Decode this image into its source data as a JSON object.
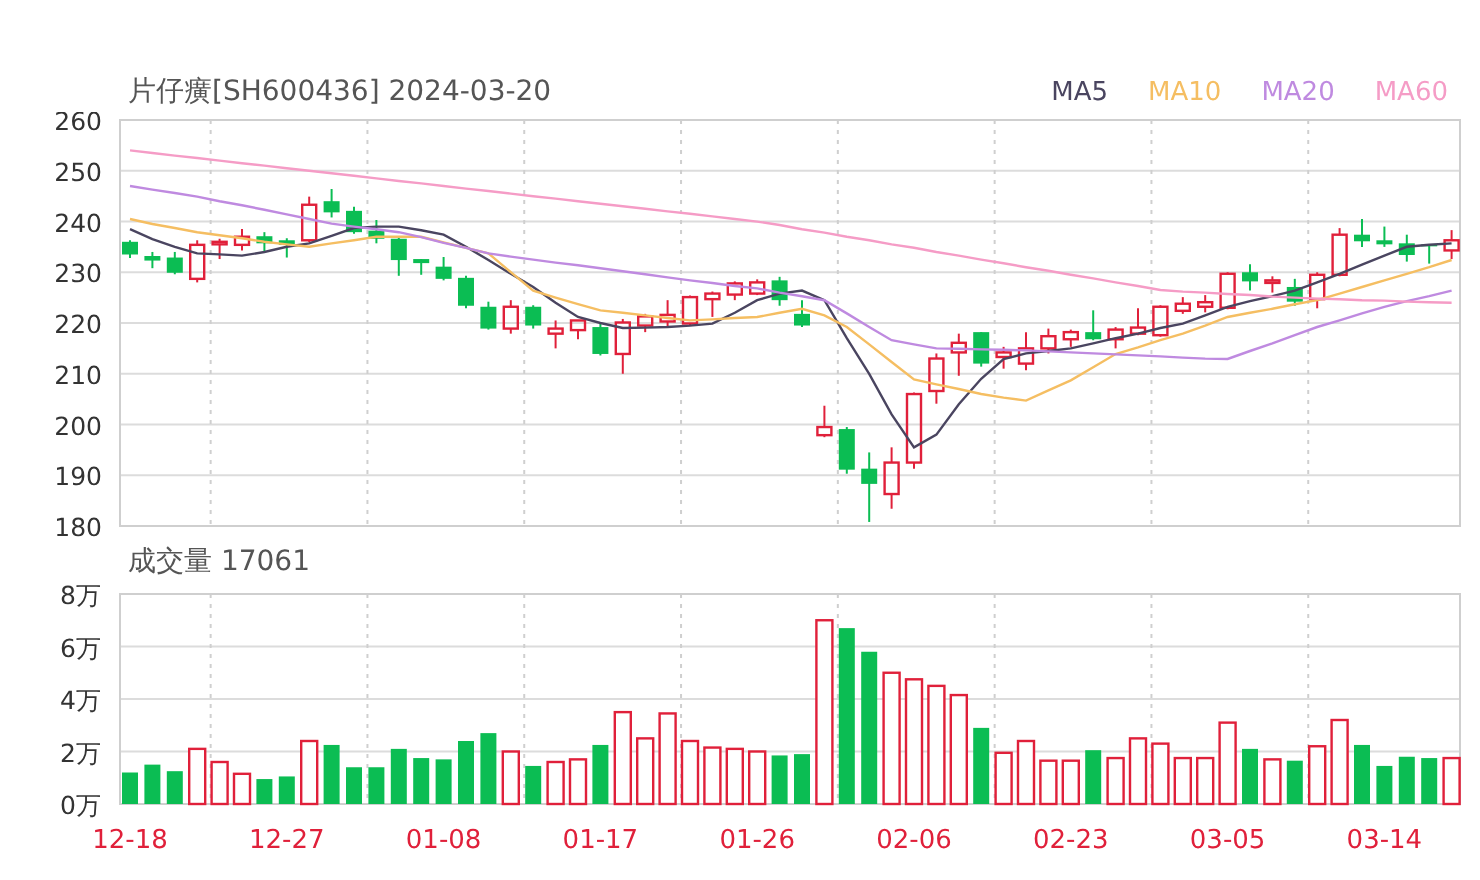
{
  "price_panel": {
    "title": "片仔癀[SH600436] 2024-03-20",
    "chart_data": {
      "type": "candlestick",
      "grid": true,
      "ylim": [
        180,
        260
      ],
      "yticks": [
        180,
        190,
        200,
        210,
        220,
        230,
        240,
        250,
        260
      ],
      "series": [
        {
          "name": "MA5",
          "type": "line",
          "color": "#4a4560",
          "values": [
            238.5,
            236.5,
            235,
            233.7,
            233.5,
            233.3,
            234,
            235,
            235.7,
            237.2,
            238.7,
            239,
            239,
            238.3,
            237.4,
            235,
            232.4,
            229.7,
            227.1,
            224,
            221.2,
            220,
            219,
            219.1,
            219.2,
            219.5,
            219.9,
            222,
            224.5,
            225.8,
            226.4,
            224.5,
            217,
            210,
            202,
            195.5,
            198,
            204,
            209,
            212.9,
            214,
            214.5,
            215,
            216,
            217,
            217.9,
            219,
            219.9,
            221.5,
            223.2,
            224.3,
            225.3,
            226.4,
            228,
            229.7,
            231.5,
            233.3,
            235,
            235.4,
            235.7
          ]
        },
        {
          "name": "MA10",
          "type": "line",
          "color": "#f5be62",
          "values": [
            240.5,
            239.5,
            238.7,
            237.9,
            237.3,
            236.7,
            236,
            235.5,
            235,
            235.7,
            236.3,
            237,
            237,
            237,
            235.9,
            234.8,
            233.7,
            230,
            226.4,
            225,
            223.7,
            222.5,
            222,
            221.5,
            221,
            220.5,
            220.7,
            221,
            221.2,
            222,
            222.8,
            221.5,
            219.2,
            215.8,
            212.3,
            208.9,
            207.9,
            207,
            206,
            205.3,
            204.7,
            206.7,
            208.7,
            211.3,
            213.9,
            215.2,
            216.6,
            217.9,
            219.5,
            221.2,
            222,
            222.8,
            223.7,
            224.5,
            225.8,
            227.1,
            228.4,
            229.7,
            231,
            232.4
          ]
        },
        {
          "name": "MA20",
          "type": "line",
          "color": "#bf8ae0",
          "values": [
            247,
            246.3,
            245.6,
            244.9,
            244,
            243.2,
            242.3,
            241.4,
            240.5,
            239.6,
            239,
            238.5,
            237.9,
            236.9,
            235.8,
            234.8,
            233.7,
            233.1,
            232.5,
            231.9,
            231.4,
            230.8,
            230.2,
            229.6,
            229,
            228.4,
            227.9,
            227.3,
            226.8,
            226,
            225.3,
            224.5,
            221.9,
            219.2,
            216.6,
            215.8,
            215,
            214.9,
            214.8,
            214.7,
            214.6,
            214.4,
            214.2,
            214,
            213.8,
            213.6,
            213.4,
            213.2,
            213,
            212.9,
            214.5,
            216,
            217.6,
            219.2,
            220.5,
            221.9,
            223.2,
            224.3,
            225.3,
            226.4
          ]
        },
        {
          "name": "MA60",
          "type": "line",
          "color": "#f59cc6",
          "values": [
            254,
            253.5,
            253,
            252.5,
            252,
            251.5,
            251,
            250.5,
            250,
            249.5,
            249,
            248.5,
            248,
            247.5,
            247,
            246.5,
            246,
            245.5,
            245,
            244.5,
            244,
            243.5,
            243,
            242.5,
            242,
            241.5,
            241,
            240.5,
            240,
            239.3,
            238.5,
            237.8,
            237,
            236.3,
            235.5,
            234.8,
            234,
            233.3,
            232.5,
            231.8,
            231,
            230.3,
            229.5,
            228.8,
            228,
            227.3,
            226.5,
            226.2,
            226,
            225.7,
            225.5,
            225.2,
            225,
            224.8,
            224.7,
            224.5,
            224.4,
            224.2,
            224.1,
            224
          ]
        }
      ],
      "ohlc": [
        [
          236,
          236.3,
          232.8,
          233.5
        ],
        [
          233.2,
          234,
          230.8,
          232.3
        ],
        [
          232.9,
          234,
          229.6,
          229.9
        ],
        [
          228.7,
          236.3,
          228,
          235.4
        ],
        [
          235.5,
          236.6,
          232.6,
          236
        ],
        [
          235.4,
          238.5,
          234.3,
          237
        ],
        [
          237.1,
          237.9,
          234,
          235.7
        ],
        [
          236.3,
          236.7,
          232.9,
          235.4
        ],
        [
          236.3,
          244.9,
          235.9,
          243.3
        ],
        [
          244,
          246.4,
          240.8,
          241.8
        ],
        [
          242.1,
          242.9,
          237.6,
          237.9
        ],
        [
          238.2,
          240.3,
          235.7,
          236.6
        ],
        [
          236.6,
          237,
          229.3,
          232.4
        ],
        [
          232.6,
          232.6,
          229.5,
          231.8
        ],
        [
          231.1,
          233,
          228.4,
          228.7
        ],
        [
          228.9,
          229.3,
          222.9,
          223.4
        ],
        [
          223.2,
          224.2,
          218.7,
          218.9
        ],
        [
          218.9,
          224.5,
          217.9,
          223.2
        ],
        [
          223.2,
          223.5,
          218.9,
          219.5
        ],
        [
          217.9,
          220.5,
          215,
          218.9
        ],
        [
          218.6,
          220.5,
          216.8,
          220.5
        ],
        [
          219.2,
          219.9,
          213.6,
          213.9
        ],
        [
          213.9,
          220.8,
          210,
          220.1
        ],
        [
          219.5,
          221.8,
          218.2,
          221.3
        ],
        [
          220.3,
          224.5,
          219.2,
          221.6
        ],
        [
          219.9,
          225.4,
          219.6,
          225.1
        ],
        [
          224.7,
          226.2,
          221.2,
          225.8
        ],
        [
          225.6,
          228.2,
          224.5,
          227.8
        ],
        [
          225.8,
          228.6,
          225.5,
          228
        ],
        [
          228.4,
          229.1,
          223.4,
          224.5
        ],
        [
          221.8,
          224.5,
          219.2,
          219.5
        ],
        [
          197.9,
          203.7,
          197.5,
          199.5
        ],
        [
          199.1,
          199.5,
          190.3,
          191.1
        ],
        [
          191.3,
          194.5,
          180.8,
          188.3
        ],
        [
          186.3,
          195.5,
          183.4,
          192.5
        ],
        [
          192.5,
          206.3,
          191.3,
          206
        ],
        [
          206.6,
          214,
          204.1,
          213
        ],
        [
          214.2,
          217.9,
          209.6,
          216.1
        ],
        [
          218.2,
          218.2,
          211.4,
          212
        ],
        [
          213.3,
          215.3,
          211,
          214.2
        ],
        [
          212,
          218.2,
          210.7,
          215
        ],
        [
          215,
          218.9,
          214,
          217.4
        ],
        [
          216.8,
          218.7,
          215.3,
          218.2
        ],
        [
          218.2,
          222.5,
          216.6,
          216.8
        ],
        [
          216.8,
          219.2,
          215,
          218.7
        ],
        [
          217.9,
          222.9,
          217.6,
          219.1
        ],
        [
          217.6,
          223.5,
          217.3,
          223.2
        ],
        [
          222.4,
          225.1,
          221.8,
          223.8
        ],
        [
          223.2,
          225.5,
          222.1,
          224.1
        ],
        [
          223,
          230,
          222.7,
          229.7
        ],
        [
          230,
          231.6,
          226.4,
          228.2
        ],
        [
          227.9,
          229.2,
          226,
          228.4
        ],
        [
          227.1,
          228.7,
          223.4,
          224.2
        ],
        [
          224.7,
          230,
          222.9,
          229.5
        ],
        [
          229.5,
          238.7,
          229.2,
          237.4
        ],
        [
          237.4,
          240.5,
          235,
          236.1
        ],
        [
          236.3,
          239,
          235,
          235.5
        ],
        [
          235.7,
          237.4,
          232.1,
          233.4
        ],
        [
          235.5,
          235.5,
          231.7,
          235.3
        ],
        [
          234.3,
          238.3,
          232.6,
          236.3
        ]
      ]
    }
  },
  "volume_panel": {
    "title": "成交量 17061",
    "chart_data": {
      "type": "bar",
      "grid": true,
      "ylim": [
        0,
        8
      ],
      "yticks": [
        {
          "value": 0,
          "label": "0万"
        },
        {
          "value": 2,
          "label": "2万"
        },
        {
          "value": 4,
          "label": "4万"
        },
        {
          "value": 6,
          "label": "6万"
        },
        {
          "value": 8,
          "label": "8万"
        }
      ],
      "categories": [
        "12-18",
        null,
        null,
        null,
        null,
        null,
        null,
        "12-27",
        null,
        null,
        null,
        null,
        null,
        null,
        "01-08",
        null,
        null,
        null,
        null,
        null,
        null,
        "01-17",
        null,
        null,
        null,
        null,
        null,
        null,
        "01-26",
        null,
        null,
        null,
        null,
        null,
        null,
        "02-06",
        null,
        null,
        null,
        null,
        null,
        null,
        "02-23",
        null,
        null,
        null,
        null,
        null,
        null,
        "03-05",
        null,
        null,
        null,
        null,
        null,
        null,
        "03-14",
        null,
        null,
        null
      ],
      "values": [
        1.2,
        1.5,
        1.25,
        2.1,
        1.6,
        1.15,
        0.95,
        1.05,
        2.4,
        2.25,
        1.4,
        1.4,
        2.1,
        1.75,
        1.7,
        2.4,
        2.7,
        2.0,
        1.45,
        1.6,
        1.7,
        2.25,
        3.5,
        2.5,
        3.45,
        2.4,
        2.15,
        2.1,
        2.0,
        1.85,
        1.9,
        7.0,
        6.7,
        5.8,
        5.0,
        4.75,
        4.5,
        4.15,
        2.9,
        1.95,
        2.4,
        1.65,
        1.65,
        2.05,
        1.75,
        2.5,
        2.3,
        1.75,
        1.75,
        3.1,
        2.1,
        1.7,
        1.65,
        2.2,
        3.2,
        2.25,
        1.45,
        1.8,
        1.75,
        1.75
      ]
    }
  }
}
